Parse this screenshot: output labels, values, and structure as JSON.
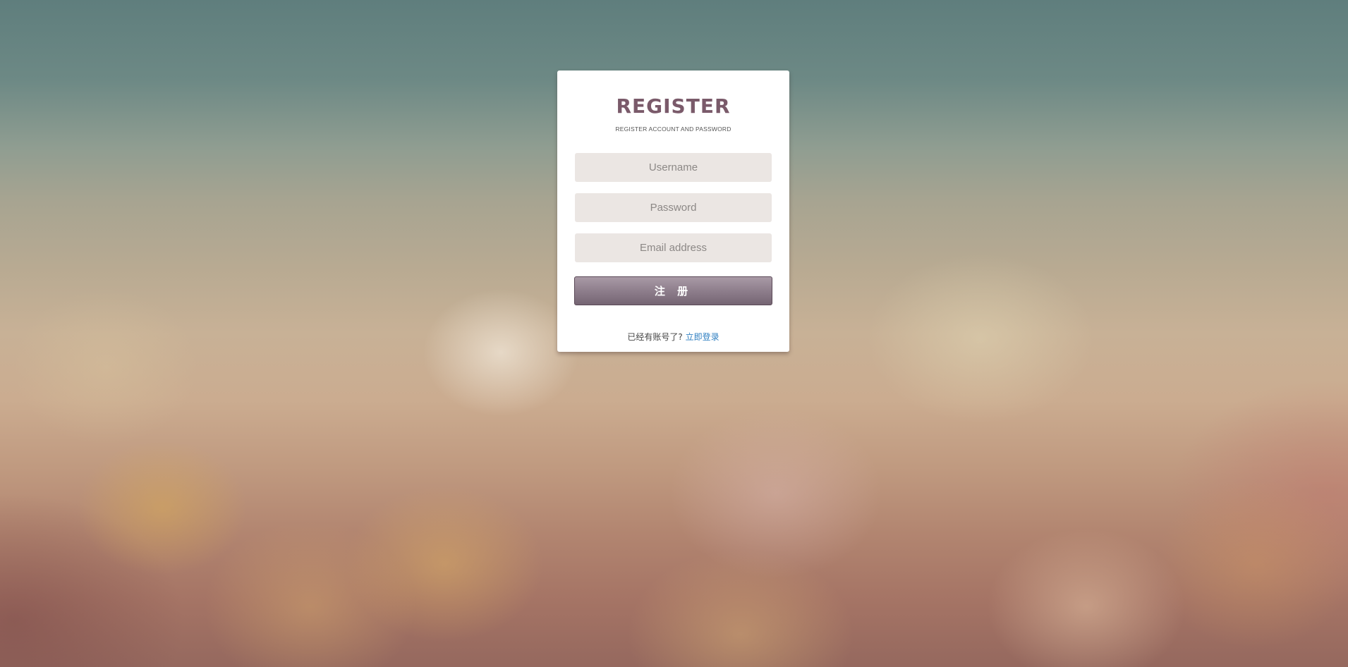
{
  "register_card": {
    "title": "REGISTER",
    "subtitle": "REGISTER ACCOUNT AND PASSWORD",
    "fields": {
      "username": {
        "value": "",
        "placeholder": "Username"
      },
      "password": {
        "value": "",
        "placeholder": "Password"
      },
      "email": {
        "value": "",
        "placeholder": "Email address"
      }
    },
    "submit_label": "注 册",
    "footer": {
      "prompt": "已经有账号了?",
      "login_link": "立即登录"
    }
  },
  "colors": {
    "title": "#7a5a6a",
    "field_bg": "#ebe6e3",
    "button_top": "#a99aa6",
    "button_bottom": "#756573",
    "link": "#2f7fc1"
  }
}
